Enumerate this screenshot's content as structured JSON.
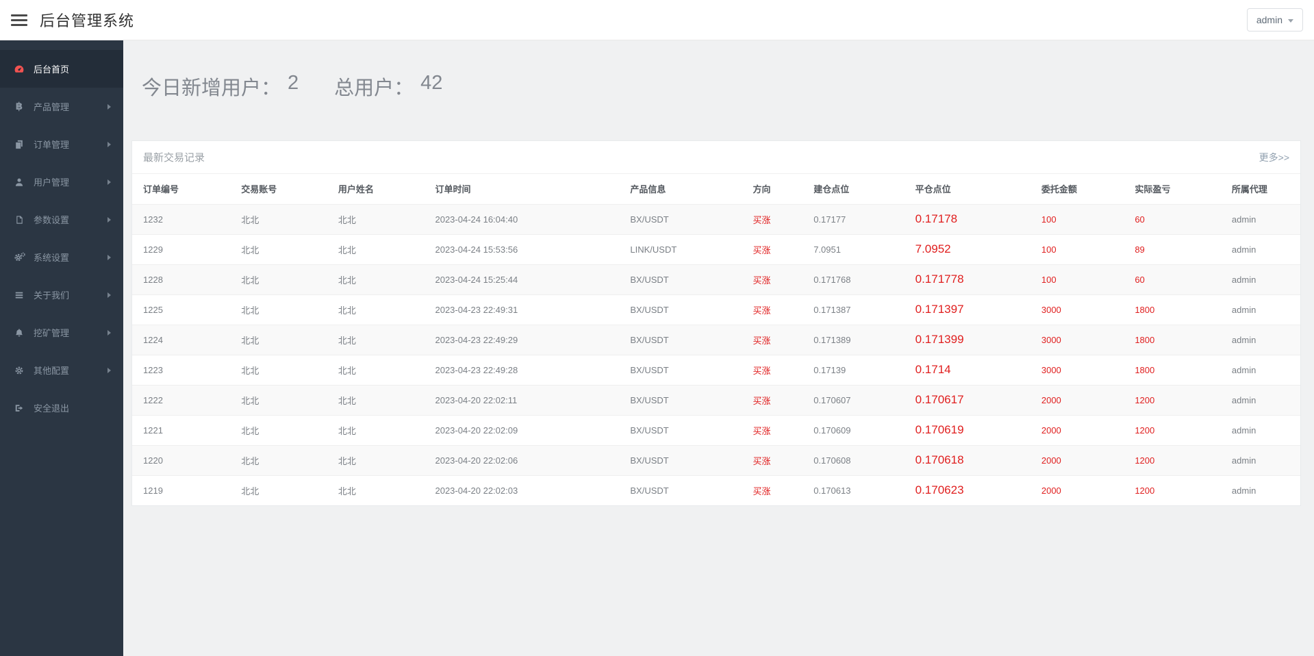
{
  "header": {
    "title": "后台管理系统",
    "user_menu_label": "admin"
  },
  "sidebar": {
    "items": [
      {
        "label": "后台首页",
        "icon": "dashboard-icon",
        "active": true,
        "has_arrow": false
      },
      {
        "label": "产品管理",
        "icon": "bitcoin-icon",
        "active": false,
        "has_arrow": true
      },
      {
        "label": "订单管理",
        "icon": "orders-icon",
        "active": false,
        "has_arrow": true
      },
      {
        "label": "用户管理",
        "icon": "user-icon",
        "active": false,
        "has_arrow": true
      },
      {
        "label": "参数设置",
        "icon": "file-icon",
        "active": false,
        "has_arrow": true
      },
      {
        "label": "系统设置",
        "icon": "cogs-icon",
        "active": false,
        "has_arrow": true
      },
      {
        "label": "关于我们",
        "icon": "list-icon",
        "active": false,
        "has_arrow": true
      },
      {
        "label": "挖矿管理",
        "icon": "bell-icon",
        "active": false,
        "has_arrow": true
      },
      {
        "label": "其他配置",
        "icon": "gear-icon",
        "active": false,
        "has_arrow": true
      },
      {
        "label": "安全退出",
        "icon": "signout-icon",
        "active": false,
        "has_arrow": false
      }
    ]
  },
  "stats": {
    "new_users_label": "今日新增用户：",
    "new_users_value": "2",
    "total_users_label": "总用户：",
    "total_users_value": "42"
  },
  "panel": {
    "title": "最新交易记录",
    "more_link": "更多>>",
    "table": {
      "columns": [
        "订单编号",
        "交易账号",
        "用户姓名",
        "订单时间",
        "产品信息",
        "方向",
        "建仓点位",
        "平仓点位",
        "委托金额",
        "实际盈亏",
        "所属代理"
      ],
      "rows": [
        [
          "1232",
          "北北",
          "北北",
          "2023-04-24 16:04:40",
          "BX/USDT",
          "买涨",
          "0.17177",
          "0.17178",
          "100",
          "60",
          "admin"
        ],
        [
          "1229",
          "北北",
          "北北",
          "2023-04-24 15:53:56",
          "LINK/USDT",
          "买涨",
          "7.0951",
          "7.0952",
          "100",
          "89",
          "admin"
        ],
        [
          "1228",
          "北北",
          "北北",
          "2023-04-24 15:25:44",
          "BX/USDT",
          "买涨",
          "0.171768",
          "0.171778",
          "100",
          "60",
          "admin"
        ],
        [
          "1225",
          "北北",
          "北北",
          "2023-04-23 22:49:31",
          "BX/USDT",
          "买涨",
          "0.171387",
          "0.171397",
          "3000",
          "1800",
          "admin"
        ],
        [
          "1224",
          "北北",
          "北北",
          "2023-04-23 22:49:29",
          "BX/USDT",
          "买涨",
          "0.171389",
          "0.171399",
          "3000",
          "1800",
          "admin"
        ],
        [
          "1223",
          "北北",
          "北北",
          "2023-04-23 22:49:28",
          "BX/USDT",
          "买涨",
          "0.17139",
          "0.1714",
          "3000",
          "1800",
          "admin"
        ],
        [
          "1222",
          "北北",
          "北北",
          "2023-04-20 22:02:11",
          "BX/USDT",
          "买涨",
          "0.170607",
          "0.170617",
          "2000",
          "1200",
          "admin"
        ],
        [
          "1221",
          "北北",
          "北北",
          "2023-04-20 22:02:09",
          "BX/USDT",
          "买涨",
          "0.170609",
          "0.170619",
          "2000",
          "1200",
          "admin"
        ],
        [
          "1220",
          "北北",
          "北北",
          "2023-04-20 22:02:06",
          "BX/USDT",
          "买涨",
          "0.170608",
          "0.170618",
          "2000",
          "1200",
          "admin"
        ],
        [
          "1219",
          "北北",
          "北北",
          "2023-04-20 22:02:03",
          "BX/USDT",
          "买涨",
          "0.170613",
          "0.170623",
          "2000",
          "1200",
          "admin"
        ]
      ]
    }
  },
  "colors": {
    "accent_red": "#e01e1e",
    "sidebar_bg": "#2b3643",
    "sidebar_active_bg": "#232d39",
    "dashboard_icon_red": "#f25351",
    "content_bg": "#f0f1f2"
  }
}
